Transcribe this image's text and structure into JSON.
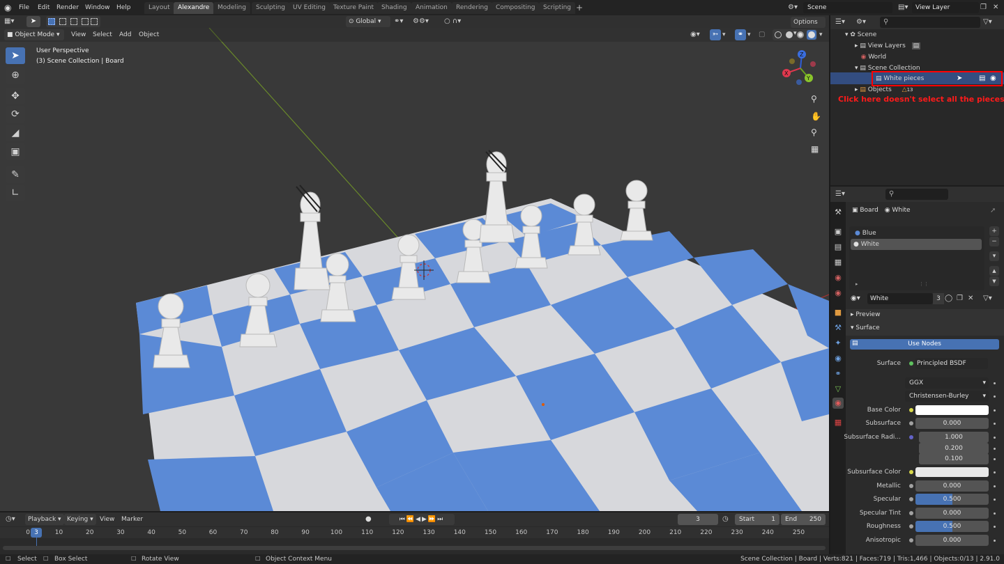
{
  "menu": {
    "items": [
      "File",
      "Edit",
      "Render",
      "Window",
      "Help"
    ]
  },
  "workspaces": [
    "Layout",
    "Alexandre",
    "Modeling",
    "Sculpting",
    "UV Editing",
    "Texture Paint",
    "Shading",
    "Animation",
    "Rendering",
    "Compositing",
    "Scripting"
  ],
  "workspace_active": "Alexandre",
  "scene_field": "Scene",
  "viewlayer_field": "View Layer",
  "viewport_header": {
    "mode": "Object Mode",
    "menus": [
      "View",
      "Select",
      "Add",
      "Object"
    ],
    "orientation": "Global",
    "options": "Options"
  },
  "viewport_info": {
    "line1": "User Perspective",
    "line2": "(3) Scene Collection | Board"
  },
  "gizmo": {
    "z": "Z",
    "y": "Y",
    "x": "X"
  },
  "annotation": {
    "text": "Click here doesn't select  all the pieces",
    "color": "#ff1a1a"
  },
  "outliner": {
    "rows": [
      {
        "label": "Scene"
      },
      {
        "label": "View Layers"
      },
      {
        "label": "World"
      },
      {
        "label": "Scene Collection"
      },
      {
        "label": "White pieces"
      },
      {
        "label": "Objects"
      }
    ],
    "objects_count": "13"
  },
  "properties": {
    "context": {
      "object": "Board",
      "material": "White"
    },
    "slots": [
      "Blue",
      "White"
    ],
    "material_name": "White",
    "users": "3",
    "preview_label": "Preview",
    "surface_label": "Surface",
    "use_nodes": "Use Nodes",
    "fields": {
      "surface_label": "Surface",
      "surface_value": "Principled BSDF",
      "distribution": "GGX",
      "subsurface_method": "Christensen-Burley",
      "base_color_label": "Base Color",
      "subsurface_label": "Subsurface",
      "subsurface_value": "0.000",
      "subsurface_radius_label": "Subsurface Radi...",
      "radius_r": "1.000",
      "radius_g": "0.200",
      "radius_b": "0.100",
      "subsurface_color_label": "Subsurface Color",
      "metallic_label": "Metallic",
      "metallic_value": "0.000",
      "specular_label": "Specular",
      "specular_value": "0.500",
      "specular_tint_label": "Specular Tint",
      "specular_tint_value": "0.000",
      "roughness_label": "Roughness",
      "roughness_value": "0.500",
      "anisotropic_label": "Anisotropic",
      "anisotropic_value": "0.000"
    },
    "specular_fill": 0.5,
    "roughness_fill": 0.5
  },
  "timeline": {
    "menus": [
      "Playback",
      "Keying",
      "View",
      "Marker"
    ],
    "current_frame": "3",
    "start_label": "Start",
    "start_value": "1",
    "end_label": "End",
    "end_value": "250",
    "ticks": [
      "0",
      "3",
      "10",
      "20",
      "30",
      "40",
      "50",
      "60",
      "70",
      "80",
      "90",
      "100",
      "110",
      "120",
      "130",
      "140",
      "150",
      "160",
      "170",
      "180",
      "190",
      "200",
      "210",
      "220",
      "230",
      "240",
      "250"
    ]
  },
  "statusbar": {
    "select": "Select",
    "box_select": "Box Select",
    "rotate_view": "Rotate View",
    "context_menu": "Object Context Menu",
    "stats": "Scene Collection | Board | Verts:821 | Faces:719 | Tris:1,466 | Objects:0/13 | 2.91.0"
  },
  "colors": {
    "accent": "#4772b3",
    "board_blue": "#5b8ad6",
    "board_white": "#d7d8dc",
    "piece": "#e9e9e9",
    "highlight": "#ff0000"
  }
}
